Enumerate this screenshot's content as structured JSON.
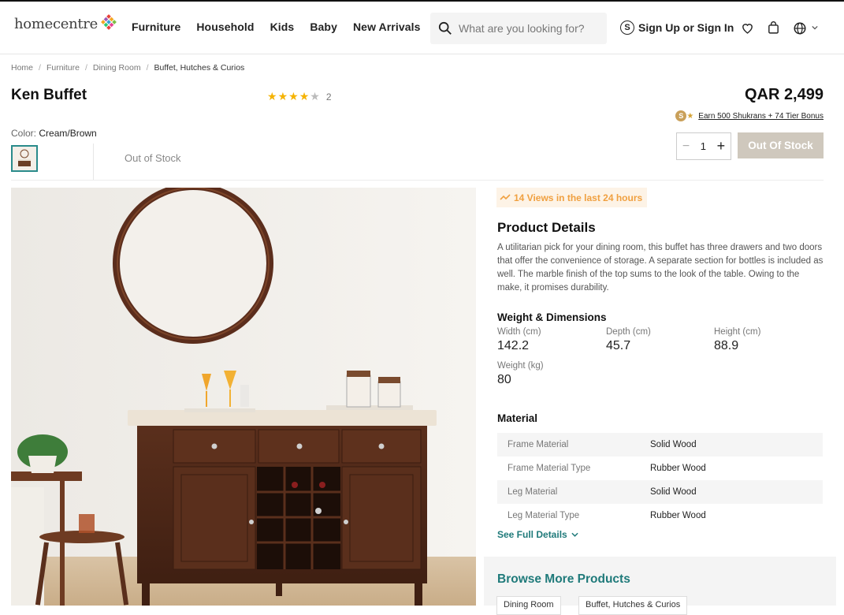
{
  "header": {
    "logo_text": "homecentre",
    "nav": [
      "Furniture",
      "Household",
      "Kids",
      "Baby",
      "New Arrivals"
    ],
    "search_placeholder": "What are you looking for?",
    "signin_label": "Sign Up or Sign In",
    "signin_circle": "S"
  },
  "breadcrumb": [
    "Home",
    "Furniture",
    "Dining Room",
    "Buffet, Hutches & Curios"
  ],
  "product": {
    "title": "Ken Buffet",
    "rating": 4,
    "rating_count": "2",
    "price": "QAR 2,499",
    "shukran_coin": "S",
    "shukran_text": "Earn 500 Shukrans + 74 Tier Bonus",
    "color_label": "Color:",
    "color_value": "Cream/Brown",
    "stock_status": "Out of Stock",
    "quantity": "1",
    "oos_button": "Out Of Stock"
  },
  "details": {
    "views": "14 Views in the last 24 hours",
    "title": "Product Details",
    "description": "A utilitarian pick for your dining room, this buffet has three drawers and two doors that offer the convenience of storage. A separate section for bottles is included as well. The marble finish of the top sums to the look of the table. Owing to the make, it promises durability.",
    "weight_title": "Weight & Dimensions",
    "dimensions": [
      {
        "label": "Width (cm)",
        "value": "142.2"
      },
      {
        "label": "Depth (cm)",
        "value": "45.7"
      },
      {
        "label": "Height (cm)",
        "value": "88.9"
      },
      {
        "label": "Weight (kg)",
        "value": "80"
      }
    ],
    "material_title": "Material",
    "materials": [
      {
        "key": "Frame Material",
        "value": "Solid Wood"
      },
      {
        "key": "Frame Material Type",
        "value": "Rubber Wood"
      },
      {
        "key": "Leg Material",
        "value": "Solid Wood"
      },
      {
        "key": "Leg Material Type",
        "value": "Rubber Wood"
      }
    ],
    "see_full": "See Full Details",
    "browse_title": "Browse More Products",
    "browse_chips": [
      "Dining Room",
      "Buffet, Hutches & Curios"
    ]
  },
  "colors": {
    "accent": "#1f7a7a",
    "star": "#f5b301",
    "oos_button": "#cfc8bd",
    "views": "#f0a040"
  }
}
